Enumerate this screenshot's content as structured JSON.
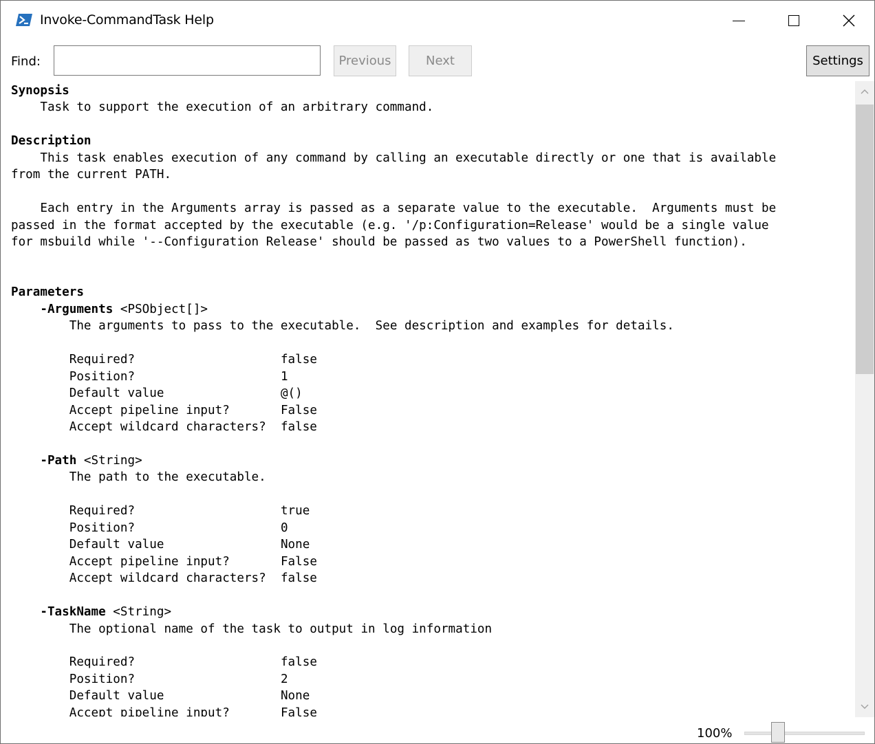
{
  "window": {
    "title": "Invoke-CommandTask Help",
    "icon": "powershell-icon",
    "controls": [
      "minimize-icon",
      "maximize-icon",
      "close-icon"
    ]
  },
  "toolbar": {
    "find_label": "Find:",
    "find_value": "",
    "previous_label": "Previous",
    "next_label": "Next",
    "settings_label": "Settings"
  },
  "help": {
    "synopsis_heading": "Synopsis",
    "synopsis_text": "    Task to support the execution of an arbitrary command.",
    "description_heading": "Description",
    "description_p1": "    This task enables execution of any command by calling an executable directly or one that is available\nfrom the current PATH.",
    "description_p2": "    Each entry in the Arguments array is passed as a separate value to the executable.  Arguments must be\npassed in the format accepted by the executable (e.g. '/p:Configuration=Release' would be a single value\nfor msbuild while '--Configuration Release' should be passed as two values to a PowerShell function).",
    "parameters_heading": "Parameters",
    "parameters": [
      {
        "name": "-Arguments",
        "type": " <PSObject[]>",
        "description": "The arguments to pass to the executable.  See description and examples for details.",
        "rows": [
          {
            "label": "Required?",
            "value": "false"
          },
          {
            "label": "Position?",
            "value": "1"
          },
          {
            "label": "Default value",
            "value": "@()"
          },
          {
            "label": "Accept pipeline input?",
            "value": "False"
          },
          {
            "label": "Accept wildcard characters?",
            "value": "false"
          }
        ]
      },
      {
        "name": "-Path",
        "type": " <String>",
        "description": "The path to the executable.",
        "rows": [
          {
            "label": "Required?",
            "value": "true"
          },
          {
            "label": "Position?",
            "value": "0"
          },
          {
            "label": "Default value",
            "value": "None"
          },
          {
            "label": "Accept pipeline input?",
            "value": "False"
          },
          {
            "label": "Accept wildcard characters?",
            "value": "false"
          }
        ]
      },
      {
        "name": "-TaskName",
        "type": " <String>",
        "description": "The optional name of the task to output in log information",
        "rows": [
          {
            "label": "Required?",
            "value": "false"
          },
          {
            "label": "Position?",
            "value": "2"
          },
          {
            "label": "Default value",
            "value": "None"
          },
          {
            "label": "Accept pipeline input?",
            "value": "False"
          }
        ]
      }
    ]
  },
  "status": {
    "zoom_label": "100%",
    "zoom_percent": 100
  }
}
